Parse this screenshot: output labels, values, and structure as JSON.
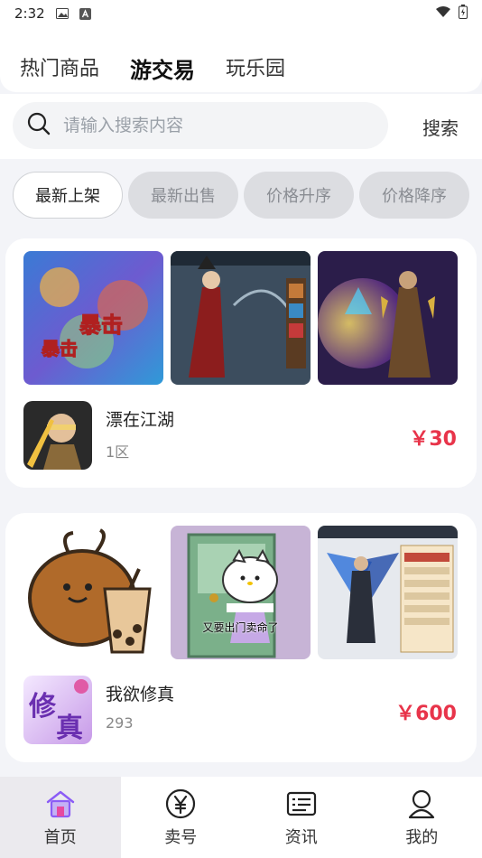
{
  "status_bar": {
    "time": "2:32"
  },
  "tabs": [
    {
      "label": "热门商品",
      "active": false
    },
    {
      "label": "游交易",
      "active": true
    },
    {
      "label": "玩乐园",
      "active": false
    }
  ],
  "search": {
    "placeholder": "请输入搜索内容",
    "button_label": "搜索"
  },
  "filters": [
    {
      "label": "最新上架",
      "active": true
    },
    {
      "label": "最新出售",
      "active": false
    },
    {
      "label": "价格升序",
      "active": false
    },
    {
      "label": "价格降序",
      "active": false
    }
  ],
  "listings": [
    {
      "name": "漂在江湖",
      "subtitle": "1区",
      "price": "￥30"
    },
    {
      "name": "我欲修真",
      "subtitle": "293",
      "price": "￥600"
    }
  ],
  "thumb_captions": {
    "hello_kitty": "又要出门卖命了"
  },
  "bottom_nav": [
    {
      "label": "首页",
      "icon": "home-icon",
      "active": true
    },
    {
      "label": "卖号",
      "icon": "yen-coin-icon",
      "active": false
    },
    {
      "label": "资讯",
      "icon": "news-icon",
      "active": false
    },
    {
      "label": "我的",
      "icon": "profile-icon",
      "active": false
    }
  ],
  "colors": {
    "accent_price": "#e8344a",
    "active_home_icon": "#8b5cf6",
    "page_bg": "#f3f4f8"
  }
}
